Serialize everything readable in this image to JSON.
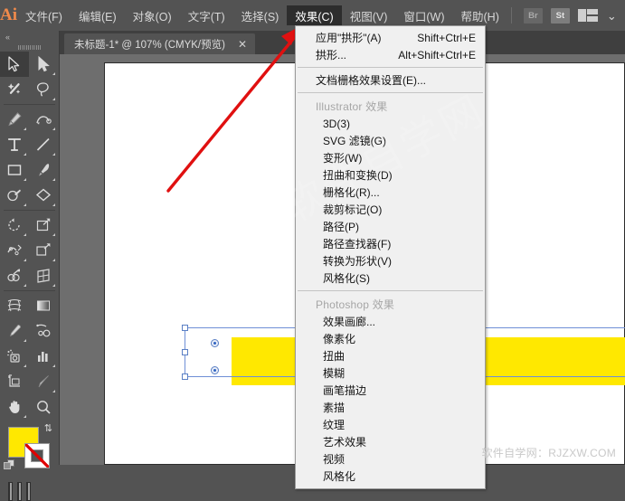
{
  "app": {
    "name": "Ai",
    "logo_color": "#f08a4b"
  },
  "menubar": {
    "items": [
      {
        "label": "文件(F)",
        "active": false
      },
      {
        "label": "编辑(E)",
        "active": false
      },
      {
        "label": "对象(O)",
        "active": false
      },
      {
        "label": "文字(T)",
        "active": false
      },
      {
        "label": "选择(S)",
        "active": false
      },
      {
        "label": "效果(C)",
        "active": true
      },
      {
        "label": "视图(V)",
        "active": false
      },
      {
        "label": "窗口(W)",
        "active": false
      },
      {
        "label": "帮助(H)",
        "active": false
      }
    ],
    "right": {
      "bridge_badge": "Br",
      "stock_badge": "St",
      "workspace_icon": "workspace-icon",
      "chevron": "⌄"
    }
  },
  "tabbar": {
    "document_title": "未标题-1* @ 107% (CMYK/预览)",
    "close_label": "✕"
  },
  "toolpanel": {
    "collapse_label": "«",
    "tools": [
      {
        "name": "selection-tool",
        "selected": true
      },
      {
        "name": "direct-selection-tool",
        "selected": false
      },
      {
        "name": "magic-wand-tool",
        "selected": false
      },
      {
        "name": "lasso-tool",
        "selected": false
      },
      {
        "name": "pen-tool",
        "selected": false
      },
      {
        "name": "curvature-tool",
        "selected": false
      },
      {
        "name": "type-tool",
        "selected": false
      },
      {
        "name": "line-segment-tool",
        "selected": false
      },
      {
        "name": "rectangle-tool",
        "selected": false
      },
      {
        "name": "paintbrush-tool",
        "selected": false
      },
      {
        "name": "shaper-tool",
        "selected": false
      },
      {
        "name": "eraser-tool",
        "selected": false
      },
      {
        "name": "rotate-tool",
        "selected": false
      },
      {
        "name": "scale-tool",
        "selected": false
      },
      {
        "name": "width-tool",
        "selected": false
      },
      {
        "name": "free-transform-tool",
        "selected": false
      },
      {
        "name": "shape-builder-tool",
        "selected": false
      },
      {
        "name": "perspective-grid-tool",
        "selected": false
      },
      {
        "name": "mesh-tool",
        "selected": false
      },
      {
        "name": "gradient-tool",
        "selected": false
      },
      {
        "name": "eyedropper-tool",
        "selected": false
      },
      {
        "name": "blend-tool",
        "selected": false
      },
      {
        "name": "symbol-sprayer-tool",
        "selected": false
      },
      {
        "name": "column-graph-tool",
        "selected": false
      },
      {
        "name": "artboard-tool",
        "selected": false
      },
      {
        "name": "slice-tool",
        "selected": false
      },
      {
        "name": "hand-tool",
        "selected": false
      },
      {
        "name": "zoom-tool",
        "selected": false
      }
    ],
    "colors": {
      "fill": "#ffe800",
      "stroke": "#ffffff",
      "stroke_none": true,
      "swap_icon": "swap-fill-stroke-icon",
      "default_icon": "default-colors-icon"
    },
    "modes": [
      {
        "name": "color-mode",
        "label": ""
      },
      {
        "name": "gradient-mode",
        "label": ""
      },
      {
        "name": "none-mode",
        "label": ""
      }
    ]
  },
  "canvas": {
    "artboard_background": "#ffffff",
    "canvas_background": "#6e6e6e",
    "shape": {
      "name": "yellow-rectangle",
      "fill": "#ffe800",
      "selected": true,
      "selection_color": "#6f8fd6"
    }
  },
  "annotation": {
    "arrow_color": "#e01010",
    "arrow_name": "red-pointer-arrow"
  },
  "dropdown": {
    "name": "effect-menu",
    "rows": [
      {
        "type": "item",
        "label": "应用\"拱形\"(A)",
        "accel": "Shift+Ctrl+E",
        "indent": false
      },
      {
        "type": "item",
        "label": "拱形...",
        "accel": "Alt+Shift+Ctrl+E",
        "indent": false
      },
      {
        "type": "sep"
      },
      {
        "type": "item",
        "label": "文档栅格效果设置(E)...",
        "accel": "",
        "indent": false
      },
      {
        "type": "sep"
      },
      {
        "type": "group",
        "label": "Illustrator 效果"
      },
      {
        "type": "item",
        "label": "3D(3)",
        "accel": "",
        "indent": true
      },
      {
        "type": "item",
        "label": "SVG 滤镜(G)",
        "accel": "",
        "indent": true
      },
      {
        "type": "item",
        "label": "变形(W)",
        "accel": "",
        "indent": true
      },
      {
        "type": "item",
        "label": "扭曲和变换(D)",
        "accel": "",
        "indent": true
      },
      {
        "type": "item",
        "label": "栅格化(R)...",
        "accel": "",
        "indent": true
      },
      {
        "type": "item",
        "label": "裁剪标记(O)",
        "accel": "",
        "indent": true
      },
      {
        "type": "item",
        "label": "路径(P)",
        "accel": "",
        "indent": true
      },
      {
        "type": "item",
        "label": "路径查找器(F)",
        "accel": "",
        "indent": true
      },
      {
        "type": "item",
        "label": "转换为形状(V)",
        "accel": "",
        "indent": true
      },
      {
        "type": "item",
        "label": "风格化(S)",
        "accel": "",
        "indent": true
      },
      {
        "type": "sep"
      },
      {
        "type": "group",
        "label": "Photoshop 效果"
      },
      {
        "type": "item",
        "label": "效果画廊...",
        "accel": "",
        "indent": true
      },
      {
        "type": "item",
        "label": "像素化",
        "accel": "",
        "indent": true
      },
      {
        "type": "item",
        "label": "扭曲",
        "accel": "",
        "indent": true
      },
      {
        "type": "item",
        "label": "模糊",
        "accel": "",
        "indent": true
      },
      {
        "type": "item",
        "label": "画笔描边",
        "accel": "",
        "indent": true
      },
      {
        "type": "item",
        "label": "素描",
        "accel": "",
        "indent": true
      },
      {
        "type": "item",
        "label": "纹理",
        "accel": "",
        "indent": true
      },
      {
        "type": "item",
        "label": "艺术效果",
        "accel": "",
        "indent": true
      },
      {
        "type": "item",
        "label": "视频",
        "accel": "",
        "indent": true
      },
      {
        "type": "item",
        "label": "风格化",
        "accel": "",
        "indent": true
      }
    ]
  },
  "watermark": {
    "bottom": "软件自学网：RJZXW.COM",
    "center": "软件自学网"
  }
}
